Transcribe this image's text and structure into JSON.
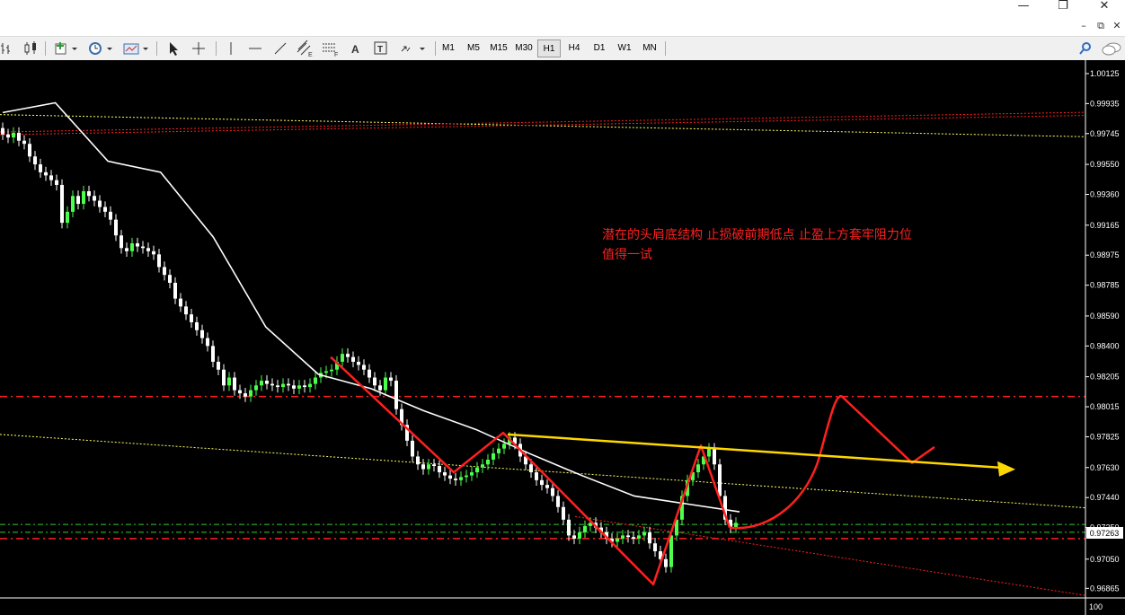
{
  "window": {
    "minimize": "—",
    "restore": "❐",
    "close": "✕",
    "mdi_min": "–",
    "mdi_restore": "⧉",
    "mdi_close": "✕"
  },
  "toolbar": {
    "timeframes": [
      "M1",
      "M5",
      "M15",
      "M30",
      "H1",
      "H4",
      "D1",
      "W1",
      "MN"
    ],
    "active_timeframe": "H1",
    "icons": [
      "bar-chart-icon",
      "candlestick-icon",
      "new-chart-icon",
      "clock-icon",
      "template-icon",
      "cursor-icon",
      "crosshair-icon",
      "vertical-line-icon",
      "horizontal-line-icon",
      "trendline-icon",
      "equidistant-channel-icon",
      "fibonacci-icon",
      "text-icon",
      "label-icon",
      "arrows-icon",
      "search-icon",
      "chat-icon"
    ]
  },
  "colors": {
    "background": "#000000",
    "bull": "#4cff4c",
    "bear": "#ffffff",
    "ma": "#ffffff",
    "red_level": "#ff2020",
    "yellow_arrow": "#ffd700",
    "annotation": "#ff2020",
    "green_level": "#33cc33"
  },
  "chart_data": {
    "type": "candlestick",
    "timeframe": "H1",
    "y_range": [
      0.9681,
      1.0021
    ],
    "y_ticks": [
      "1.00125",
      "0.99935",
      "0.99745",
      "0.99550",
      "0.99360",
      "0.99165",
      "0.98975",
      "0.98785",
      "0.98590",
      "0.98400",
      "0.98205",
      "0.98015",
      "0.97825",
      "0.97630",
      "0.97440",
      "0.97250",
      "0.97050",
      "0.96865"
    ],
    "current_price": "0.97263",
    "bottom_label": "100",
    "annotation_text": [
      "潜在的头肩底结构 止损破前期低点 止盈上方套牢阻力位",
      "值得一试"
    ],
    "levels": {
      "red_resistance": 0.9808,
      "red_support": 0.9718,
      "green_level_1": 0.9727,
      "green_level_2": 0.9722,
      "red_channel_top": 0.9978
    },
    "candle_closes": [
      0.9974,
      0.9972,
      0.9975,
      0.997,
      0.9968,
      0.996,
      0.9955,
      0.995,
      0.9948,
      0.9945,
      0.9942,
      0.9918,
      0.9925,
      0.9935,
      0.993,
      0.9938,
      0.9935,
      0.9932,
      0.9928,
      0.9925,
      0.992,
      0.991,
      0.9902,
      0.99,
      0.9905,
      0.9903,
      0.9902,
      0.99,
      0.9898,
      0.989,
      0.9885,
      0.988,
      0.987,
      0.9865,
      0.986,
      0.9855,
      0.985,
      0.9845,
      0.984,
      0.983,
      0.9825,
      0.9815,
      0.982,
      0.9812,
      0.981,
      0.9808,
      0.9812,
      0.9815,
      0.9818,
      0.9816,
      0.9815,
      0.9814,
      0.9816,
      0.9815,
      0.9813,
      0.9815,
      0.9814,
      0.9816,
      0.982,
      0.9823,
      0.9824,
      0.9825,
      0.983,
      0.9835,
      0.9833,
      0.983,
      0.9828,
      0.9825,
      0.982,
      0.9815,
      0.9812,
      0.982,
      0.9818,
      0.98,
      0.979,
      0.978,
      0.977,
      0.9765,
      0.9762,
      0.9765,
      0.9764,
      0.976,
      0.9758,
      0.9756,
      0.9755,
      0.9757,
      0.9758,
      0.976,
      0.9763,
      0.9765,
      0.9768,
      0.9772,
      0.9775,
      0.9778,
      0.9782,
      0.9778,
      0.977,
      0.9765,
      0.976,
      0.9755,
      0.9752,
      0.975,
      0.9745,
      0.9738,
      0.973,
      0.972,
      0.9718,
      0.9722,
      0.9726,
      0.9728,
      0.9725,
      0.9722,
      0.9718,
      0.9716,
      0.9718,
      0.972,
      0.9719,
      0.9718,
      0.972,
      0.9722,
      0.9715,
      0.971,
      0.9705,
      0.97,
      0.972,
      0.973,
      0.9745,
      0.9755,
      0.976,
      0.9765,
      0.977,
      0.9775,
      0.9765,
      0.9745,
      0.973,
      0.9725,
      0.9728
    ],
    "moving_average": [
      [
        0.99878,
        0.9985
      ],
      [
        0.9994,
        0.9978
      ],
      [
        0.9957,
        0.9923
      ],
      [
        0.995,
        0.9889
      ],
      [
        0.9909,
        0.986
      ],
      [
        0.9852,
        0.9838
      ],
      [
        0.9822,
        0.982
      ],
      [
        0.9813,
        0.98
      ],
      [
        0.9799,
        0.9788
      ],
      [
        0.9787,
        0.9772
      ],
      [
        0.9772,
        0.9756
      ],
      [
        0.9758,
        0.9745
      ],
      [
        0.9745,
        0.974
      ],
      [
        0.974,
        0.9735
      ],
      [
        0.9735,
        0.9732
      ]
    ],
    "red_neckline_sketch": "potential head-and-shoulders bottom with projected breakout",
    "yellow_neckline": {
      "from_price": 0.9784,
      "to_price": 0.9763
    }
  }
}
